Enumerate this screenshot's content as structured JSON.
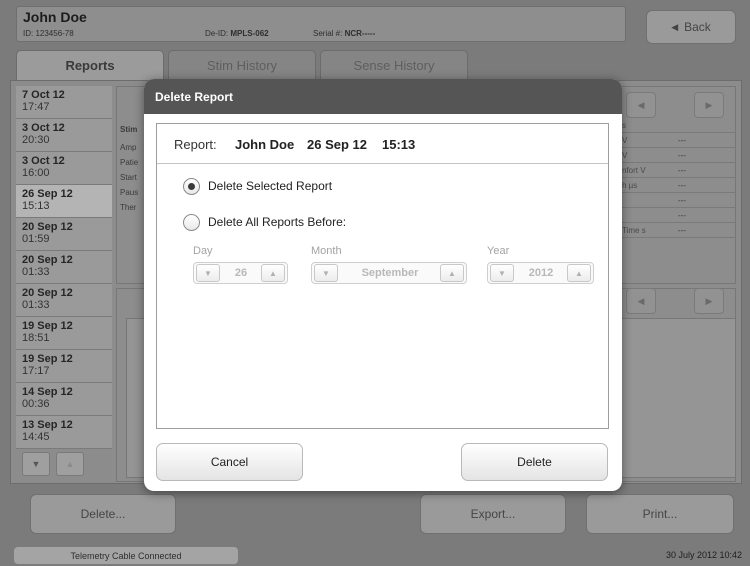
{
  "header": {
    "patient_name": "John Doe",
    "patient_id": "ID: 123456-78",
    "deid_label": "De-ID:",
    "deid_value": "MPLS-062",
    "serial_label": "Serial #:",
    "serial_value": "NCR-----",
    "back_label": "Back"
  },
  "tabs": [
    {
      "label": "Reports"
    },
    {
      "label": "Stim History"
    },
    {
      "label": "Sense History"
    }
  ],
  "reports": [
    {
      "date": "7 Oct 12",
      "time": "17:47"
    },
    {
      "date": "3 Oct 12",
      "time": "20:30"
    },
    {
      "date": "3 Oct 12",
      "time": "16:00"
    },
    {
      "date": "26 Sep 12",
      "time": "15:13"
    },
    {
      "date": "20 Sep 12",
      "time": "01:59"
    },
    {
      "date": "20 Sep 12",
      "time": "01:33"
    },
    {
      "date": "20 Sep 12",
      "time": "01:33"
    },
    {
      "date": "19 Sep 12",
      "time": "18:51"
    },
    {
      "date": "19 Sep 12",
      "time": "17:17"
    },
    {
      "date": "14 Sep 12",
      "time": "00:36"
    },
    {
      "date": "13 Sep 12",
      "time": "14:45"
    }
  ],
  "selected_report_index": 3,
  "background_panel": {
    "stim_header": "Stim",
    "left_labels": [
      "Amp",
      "Patie",
      "Start",
      "Paus",
      "Ther"
    ],
    "right_rows": [
      {
        "key": "s",
        "value": ""
      },
      {
        "key": "V",
        "value": "---"
      },
      {
        "key": "V",
        "value": "---"
      },
      {
        "key": "nfort V",
        "value": "---"
      },
      {
        "key": "h µs",
        "value": "---"
      },
      {
        "key": "",
        "value": "---"
      },
      {
        "key": "",
        "value": "---"
      },
      {
        "key": "Time s",
        "value": "---"
      }
    ]
  },
  "bottom_bar": {
    "delete_label": "Delete...",
    "export_label": "Export...",
    "print_label": "Print..."
  },
  "status": {
    "connection": "Telemetry Cable Connected",
    "datetime": "30 July 2012 10:42"
  },
  "dialog": {
    "title": "Delete Report",
    "report_label": "Report:",
    "report_name": "John Doe",
    "report_date": "26 Sep 12",
    "report_time": "15:13",
    "option_selected": "Delete Selected Report",
    "option_all_before": "Delete All Reports Before:",
    "day_label": "Day",
    "day_value": "26",
    "month_label": "Month",
    "month_value": "September",
    "year_label": "Year",
    "year_value": "2012",
    "cancel_label": "Cancel",
    "delete_label": "Delete"
  },
  "colors": {
    "dialog_title_bar": "#555555",
    "overlay_background": "#7b7b7b",
    "selected_list_item": "#b4b4b4"
  },
  "icons": {
    "back": "back-triangle-icon",
    "spin_down": "triangle-down-icon",
    "spin_up": "triangle-up-icon",
    "nav_left": "triangle-left-icon",
    "nav_right": "triangle-right-icon"
  }
}
